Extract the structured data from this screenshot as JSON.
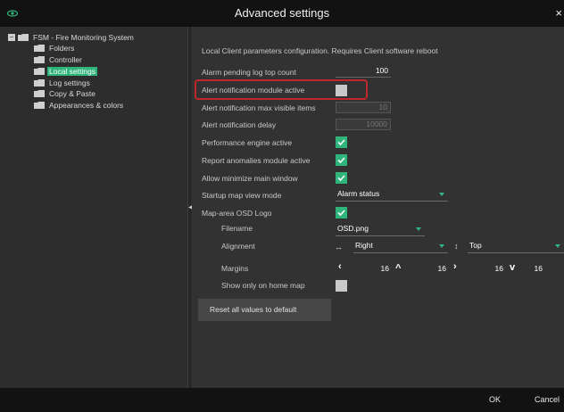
{
  "window": {
    "title": "Advanced settings",
    "close_glyph": "×",
    "app_icon": "eye-icon"
  },
  "tree": {
    "root_label": "FSM - Fire Monitoring System",
    "expand_glyph": "−",
    "items": [
      {
        "label": "Folders",
        "selected": false
      },
      {
        "label": "Controller",
        "selected": false
      },
      {
        "label": "Local settings",
        "selected": true
      },
      {
        "label": "Log settings",
        "selected": false
      },
      {
        "label": "Copy & Paste",
        "selected": false
      },
      {
        "label": "Appearances & colors",
        "selected": false
      }
    ],
    "splitter_arrow": "◀"
  },
  "settings": {
    "header": "Local Client parameters configuration. Requires Client software reboot",
    "alarm_pending": {
      "label": "Alarm pending log top count",
      "value": "100"
    },
    "alert_module": {
      "label": "Alert notification module active",
      "checked": false
    },
    "alert_max": {
      "label": "Alert notification max visible items",
      "value": "10"
    },
    "alert_delay": {
      "label": "Alert notification delay",
      "value": "10000"
    },
    "performance": {
      "label": "Performance engine active",
      "checked": true
    },
    "anomalies": {
      "label": "Report anomalies module active",
      "checked": true
    },
    "minimize": {
      "label": "Allow minimize main window",
      "checked": true
    },
    "startup_map": {
      "label": "Startup map view mode",
      "value": "Alarm status"
    },
    "osd_logo": {
      "label": "Map-area OSD Logo",
      "checked": true
    },
    "filename": {
      "label": "Filename",
      "value": "OSD.png"
    },
    "alignment": {
      "label": "Alignment",
      "horizontal_icon": "↔",
      "horizontal": "Right",
      "vertical_icon": "↕",
      "vertical": "Top"
    },
    "margins": {
      "label": "Margins",
      "left_icon": "‹",
      "left": "16",
      "top_icon": "^",
      "top": "16",
      "right_icon": "›",
      "right": "16",
      "bottom_icon": "v",
      "bottom": "16"
    },
    "home_only": {
      "label": "Show only on home map",
      "checked": false
    },
    "reset_label": "Reset all values to default"
  },
  "footer": {
    "ok": "OK",
    "cancel": "Cancel"
  },
  "colors": {
    "accent": "#2fb47c",
    "highlight": "#c0272b",
    "titlebar": "#121212"
  }
}
